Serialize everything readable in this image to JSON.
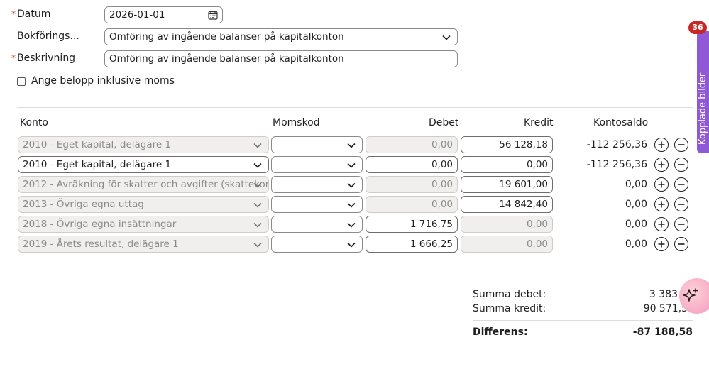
{
  "form": {
    "date_label": "Datum",
    "date_value": "2026-01-01",
    "series_label": "Bokförings...",
    "series_value": "Omföring av ingående balanser på kapitalkonton",
    "description_label": "Beskrivning",
    "description_value": "Omföring av ingående balanser på kapitalkonton",
    "required_mark": "*",
    "vat_checkbox_label": "Ange belopp inklusive moms",
    "vat_checked": false
  },
  "table": {
    "headers": {
      "account": "Konto",
      "vat_code": "Momskod",
      "debit": "Debet",
      "credit": "Kredit",
      "balance": "Kontosaldo"
    },
    "rows": [
      {
        "account": "2010 - Eget kapital, delägare 1",
        "account_state": "disabled",
        "vat": "",
        "debit": "0,00",
        "debit_state": "disabled",
        "credit": "56 128,18",
        "credit_state": "active",
        "balance": "-112 256,36"
      },
      {
        "account": "2010 - Eget kapital, delägare 1",
        "account_state": "active",
        "vat": "",
        "debit": "0,00",
        "debit_state": "active",
        "credit": "0,00",
        "credit_state": "active",
        "balance": "-112 256,36"
      },
      {
        "account": "2012 - Avräkning för skatter och avgifter (skattekont",
        "account_state": "disabled",
        "vat": "",
        "debit": "0,00",
        "debit_state": "disabled",
        "credit": "19 601,00",
        "credit_state": "active",
        "balance": "0,00"
      },
      {
        "account": "2013 - Övriga egna uttag",
        "account_state": "disabled",
        "vat": "",
        "debit": "0,00",
        "debit_state": "disabled",
        "credit": "14 842,40",
        "credit_state": "active",
        "balance": "0,00"
      },
      {
        "account": "2018 - Övriga egna insättningar",
        "account_state": "disabled",
        "vat": "",
        "debit": "1 716,75",
        "debit_state": "active",
        "credit": "0,00",
        "credit_state": "disabled",
        "balance": "0,00"
      },
      {
        "account": "2019 - Årets resultat, delägare 1",
        "account_state": "disabled",
        "vat": "",
        "debit": "1 666,25",
        "debit_state": "active",
        "credit": "0,00",
        "credit_state": "disabled",
        "balance": "0,00"
      }
    ]
  },
  "summary": {
    "debit_label": "Summa debet:",
    "debit_value": "3 383",
    "credit_label": "Summa kredit:",
    "credit_value": "90 571,5",
    "diff_label": "Differens:",
    "diff_value": "-87 188,58"
  },
  "sidebar": {
    "tab_label": "Kopplade bilder",
    "badge_count": "36",
    "tab_color": "#8e58d6",
    "badge_color": "#c62828"
  },
  "assistant": {
    "icon": "sparkle-icon"
  }
}
